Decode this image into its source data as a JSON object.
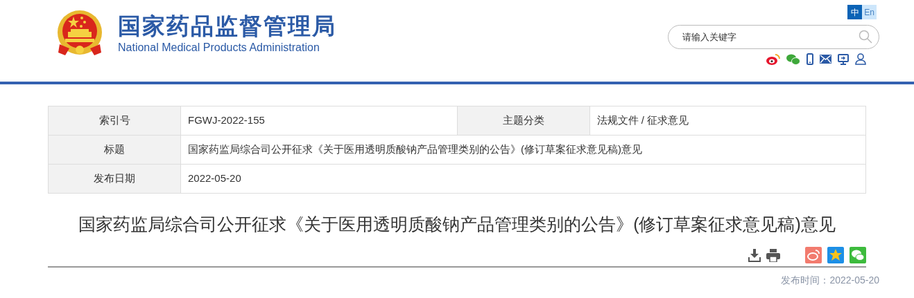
{
  "header": {
    "title": "国家药品监督管理局",
    "subtitle": "National Medical Products Administration"
  },
  "languages": [
    {
      "label": "中",
      "selected": true
    },
    {
      "label": "En",
      "selected": false
    }
  ],
  "search": {
    "placeholder": "请输入关键字"
  },
  "info_table": {
    "rows": [
      {
        "cells": [
          {
            "label": "索引号",
            "value": "FGWJ-2022-155"
          },
          {
            "label": "主题分类",
            "value": "法规文件 / 征求意见"
          }
        ]
      },
      {
        "cells": [
          {
            "label": "标题",
            "value": "国家药监局综合司公开征求《关于医用透明质酸钠产品管理类别的公告》(修订草案征求意见稿)意见"
          }
        ]
      },
      {
        "cells": [
          {
            "label": "发布日期",
            "value": "2022-05-20"
          }
        ]
      }
    ]
  },
  "article": {
    "title": "国家药监局综合司公开征求《关于医用透明质酸钠产品管理类别的公告》(修订草案征求意见稿)意见",
    "publish_label": "发布时间：",
    "publish_date": "2022-05-20"
  }
}
